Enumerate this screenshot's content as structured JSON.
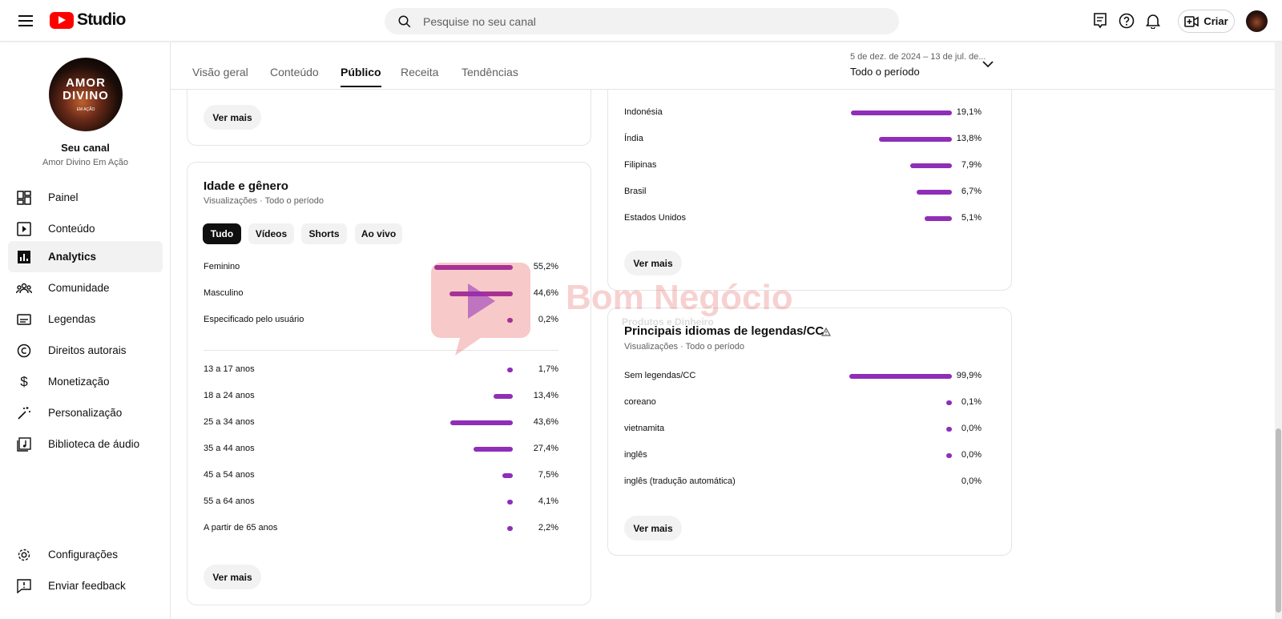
{
  "header": {
    "logo_text": "Studio",
    "search_placeholder": "Pesquise no seu canal",
    "create_label": "Criar"
  },
  "sidebar": {
    "avatar_line1": "AMOR",
    "avatar_line2": "DIVINO",
    "avatar_line3": "EM AÇÃO",
    "channel_title": "Seu canal",
    "channel_name": "Amor Divino Em Ação",
    "items": [
      {
        "label": "Painel",
        "icon": "dashboard-icon"
      },
      {
        "label": "Conteúdo",
        "icon": "content-icon"
      },
      {
        "label": "Analytics",
        "icon": "analytics-icon"
      },
      {
        "label": "Comunidade",
        "icon": "community-icon"
      },
      {
        "label": "Legendas",
        "icon": "subtitles-icon"
      },
      {
        "label": "Direitos autorais",
        "icon": "copyright-icon"
      },
      {
        "label": "Monetização",
        "icon": "dollar-icon"
      },
      {
        "label": "Personalização",
        "icon": "magic-wand-icon"
      },
      {
        "label": "Biblioteca de áudio",
        "icon": "audio-library-icon"
      }
    ],
    "bottom_items": [
      {
        "label": "Configurações",
        "icon": "gear-icon"
      },
      {
        "label": "Enviar feedback",
        "icon": "feedback-icon"
      }
    ]
  },
  "tabs": [
    "Visão geral",
    "Conteúdo",
    "Público",
    "Receita",
    "Tendências"
  ],
  "period": {
    "range": "5 de dez. de 2024 – 13 de jul. de...",
    "label": "Todo o período"
  },
  "top_card": {
    "more_label": "Ver mais"
  },
  "age_gender": {
    "title": "Idade e gênero",
    "subtitle": "Visualizações · Todo o período",
    "chips": [
      "Tudo",
      "Vídeos",
      "Shorts",
      "Ao vivo"
    ],
    "gender": [
      {
        "label": "Feminino",
        "value": "55,2%",
        "pct": 55.2
      },
      {
        "label": "Masculino",
        "value": "44,6%",
        "pct": 44.6
      },
      {
        "label": "Especificado pelo usuário",
        "value": "0,2%",
        "pct": 0.2
      }
    ],
    "ages": [
      {
        "label": "13 a 17 anos",
        "value": "1,7%",
        "pct": 1.7
      },
      {
        "label": "18 a 24 anos",
        "value": "13,4%",
        "pct": 13.4
      },
      {
        "label": "25 a 34 anos",
        "value": "43,6%",
        "pct": 43.6
      },
      {
        "label": "35 a 44 anos",
        "value": "27,4%",
        "pct": 27.4
      },
      {
        "label": "45 a 54 anos",
        "value": "7,5%",
        "pct": 7.5
      },
      {
        "label": "55 a 64 anos",
        "value": "4,1%",
        "pct": 4.1
      },
      {
        "label": "A partir de 65 anos",
        "value": "2,2%",
        "pct": 2.2
      }
    ],
    "more_label": "Ver mais"
  },
  "countries": {
    "rows": [
      {
        "label": "Indonésia",
        "value": "19,1%",
        "pct": 19.1
      },
      {
        "label": "Índia",
        "value": "13,8%",
        "pct": 13.8
      },
      {
        "label": "Filipinas",
        "value": "7,9%",
        "pct": 7.9
      },
      {
        "label": "Brasil",
        "value": "6,7%",
        "pct": 6.7
      },
      {
        "label": "Estados Unidos",
        "value": "5,1%",
        "pct": 5.1
      }
    ],
    "more_label": "Ver mais"
  },
  "languages": {
    "title": "Principais idiomas de legendas/CC",
    "subtitle": "Visualizações · Todo o período",
    "rows": [
      {
        "label": "Sem legendas/CC",
        "value": "99,9%",
        "pct": 99.9
      },
      {
        "label": "coreano",
        "value": "0,1%",
        "pct": 0.1
      },
      {
        "label": "vietnamita",
        "value": "0,0%",
        "pct": 0.02
      },
      {
        "label": "inglês",
        "value": "0,0%",
        "pct": 0.02
      },
      {
        "label": "inglês (tradução automática)",
        "value": "0,0%",
        "pct": 0
      }
    ],
    "more_label": "Ver mais"
  },
  "watermark": {
    "text": "Bom Negócio",
    "tagline": "Produtos e Dinheiro"
  },
  "colors": {
    "bar": "#8f2eb8",
    "brand": "#ff0000",
    "chip_active": "#0f0f0f"
  }
}
